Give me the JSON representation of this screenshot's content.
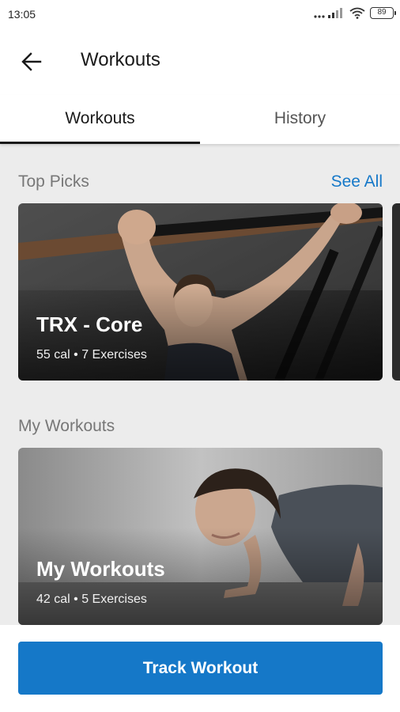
{
  "status": {
    "time": "13:05",
    "battery": "89"
  },
  "header": {
    "title": "Workouts"
  },
  "tabs": [
    {
      "label": "Workouts"
    },
    {
      "label": "History"
    }
  ],
  "top_picks": {
    "title": "Top Picks",
    "see_all": "See All",
    "cards": [
      {
        "title": "TRX - Core",
        "subtitle": "55 cal • 7 Exercises"
      }
    ]
  },
  "my_workouts": {
    "title": "My Workouts",
    "cards": [
      {
        "title": "My Workouts",
        "subtitle": "42 cal • 5 Exercises"
      }
    ]
  },
  "footer": {
    "button_label": "Track Workout"
  },
  "colors": {
    "accent": "#1578c8",
    "background": "#ececec"
  }
}
